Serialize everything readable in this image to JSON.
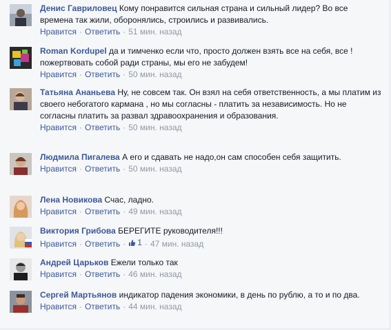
{
  "comments": [
    {
      "author": "Денис Гавриловец",
      "text": "Кому понравится сильная страна и сильный лидер? Во все времена так жили, оборонялись, строились и развивались.",
      "like_label": "Нравится",
      "reply_label": "Ответить",
      "time": "51 мин. назад"
    },
    {
      "author": "Roman Kordupel",
      "text": "да и тимченко если что, просто должен взять все на себя, все ! пожертвовать собой ради страны, мы его не забудем!",
      "like_label": "Нравится",
      "reply_label": "Ответить",
      "time": "50 мин. назад"
    },
    {
      "author": "Татьяна Ананьева",
      "text": "Ну, не совсем так. Он взял на себя ответственность, а мы платим из своего небогатого кармана , но мы согласны - платить за независимость. Но не согласны платить за развал здравоохранения и образования.",
      "like_label": "Нравится",
      "reply_label": "Ответить",
      "time": "50 мин. назад"
    },
    {
      "author": "Людмила Пигалева",
      "text": "А его и сдавать не надо,он сам способен себя защитить.",
      "like_label": "Нравится",
      "reply_label": "Ответить",
      "time": "50 мин. назад"
    },
    {
      "author": "Лена Новикова",
      "text": "Счас, ладно.",
      "like_label": "Нравится",
      "reply_label": "Ответить",
      "time": "49 мин. назад"
    },
    {
      "author": "Виктория Грибова",
      "text": "БЕРЕГИТЕ руководителя!!!",
      "like_label": "Нравится",
      "reply_label": "Ответить",
      "like_count": "1",
      "time": "47 мин. назад"
    },
    {
      "author": "Андрей Царьков",
      "text": "Ежели только так",
      "like_label": "Нравится",
      "reply_label": "Ответить",
      "time": "46 мин. назад"
    },
    {
      "author": "Сергей Мартьянов",
      "text": "индикатор падения экономики, в день по рублю, а то и по два.",
      "like_label": "Нравится",
      "reply_label": "Ответить",
      "time": "44 мин. назад"
    }
  ],
  "separator": "·",
  "colors": {
    "link": "#3b5998",
    "meta": "#9197a3",
    "text": "#141823",
    "background": "#f6f7f9"
  },
  "icons": {
    "like_count_icon": "thumbs-up-icon"
  }
}
